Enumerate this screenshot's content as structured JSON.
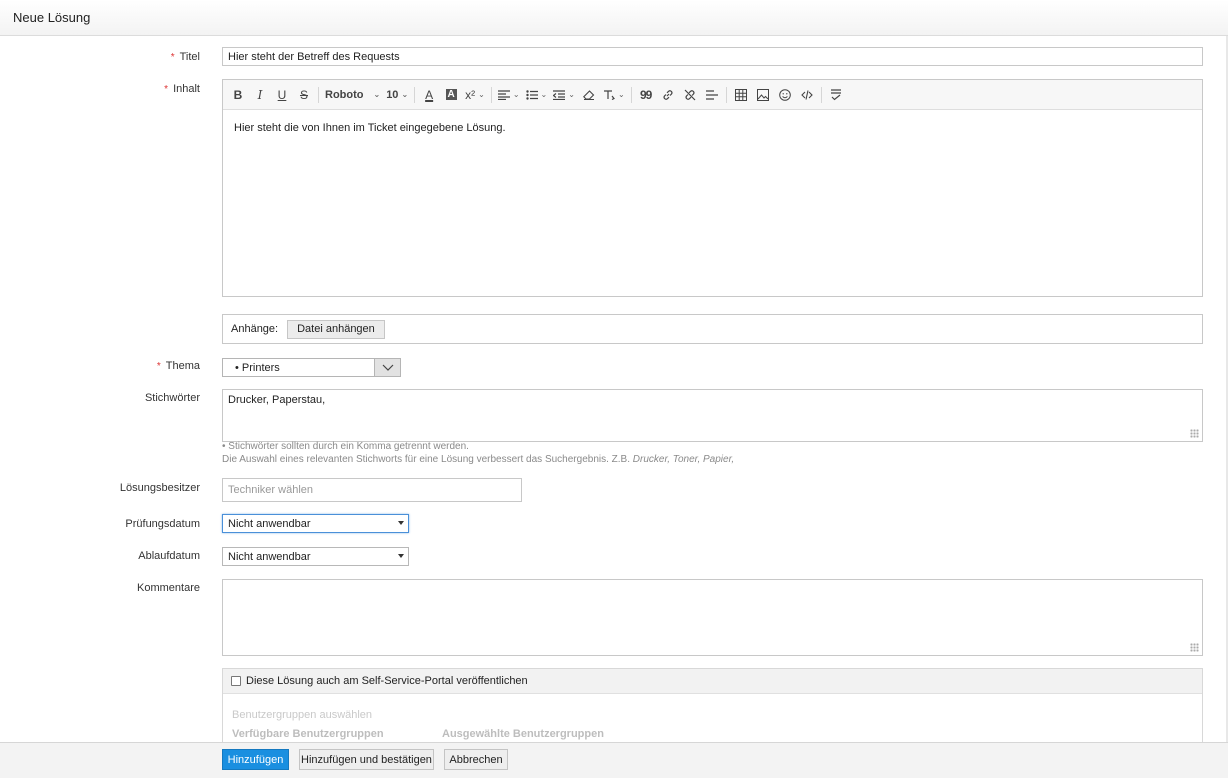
{
  "header": {
    "title": "Neue Lösung"
  },
  "form": {
    "title_label": "Titel",
    "title_value": "Hier steht der Betreff des Requests",
    "content_label": "Inhalt",
    "content_text": "Hier steht die von Ihnen im Ticket eingegebene Lösung.",
    "toolbar": {
      "bold": "B",
      "italic": "I",
      "underline": "U",
      "strike": "S",
      "font": "Roboto",
      "size": "10",
      "font_color": "A",
      "bg_color": "A",
      "superscript": "x²",
      "quote": "99"
    },
    "attachments_label": "Anhänge:",
    "attach_button": "Datei anhängen",
    "theme_label": "Thema",
    "theme_value": "• Printers",
    "keywords_label": "Stichwörter",
    "keywords_value": "Drucker, Paperstau,",
    "keywords_hint_1": "• Stichwörter sollten durch ein Komma getrennt werden.",
    "keywords_hint_2": "Die Auswahl eines relevanten Stichworts für eine Lösung verbessert das Suchergebnis. Z.B.",
    "keywords_hint_example": "Drucker, Toner, Papier,",
    "owner_label": "Lösungsbesitzer",
    "owner_placeholder": "Techniker wählen",
    "review_label": "Prüfungsdatum",
    "review_value": "Nicht anwendbar",
    "expiry_label": "Ablaufdatum",
    "expiry_value": "Nicht anwendbar",
    "comments_label": "Kommentare",
    "publish_label": "Diese Lösung auch am Self-Service-Portal veröffentlichen",
    "usergroups_label": "Benutzergruppen auswählen",
    "available_groups": "Verfügbare Benutzergruppen",
    "selected_groups": "Ausgewählte Benutzergruppen"
  },
  "footer": {
    "add": "Hinzufügen",
    "add_approve": "Hinzufügen und bestätigen",
    "cancel": "Abbrechen"
  },
  "colors": {
    "primary": "#1a8fe0",
    "required": "#dd3333"
  }
}
